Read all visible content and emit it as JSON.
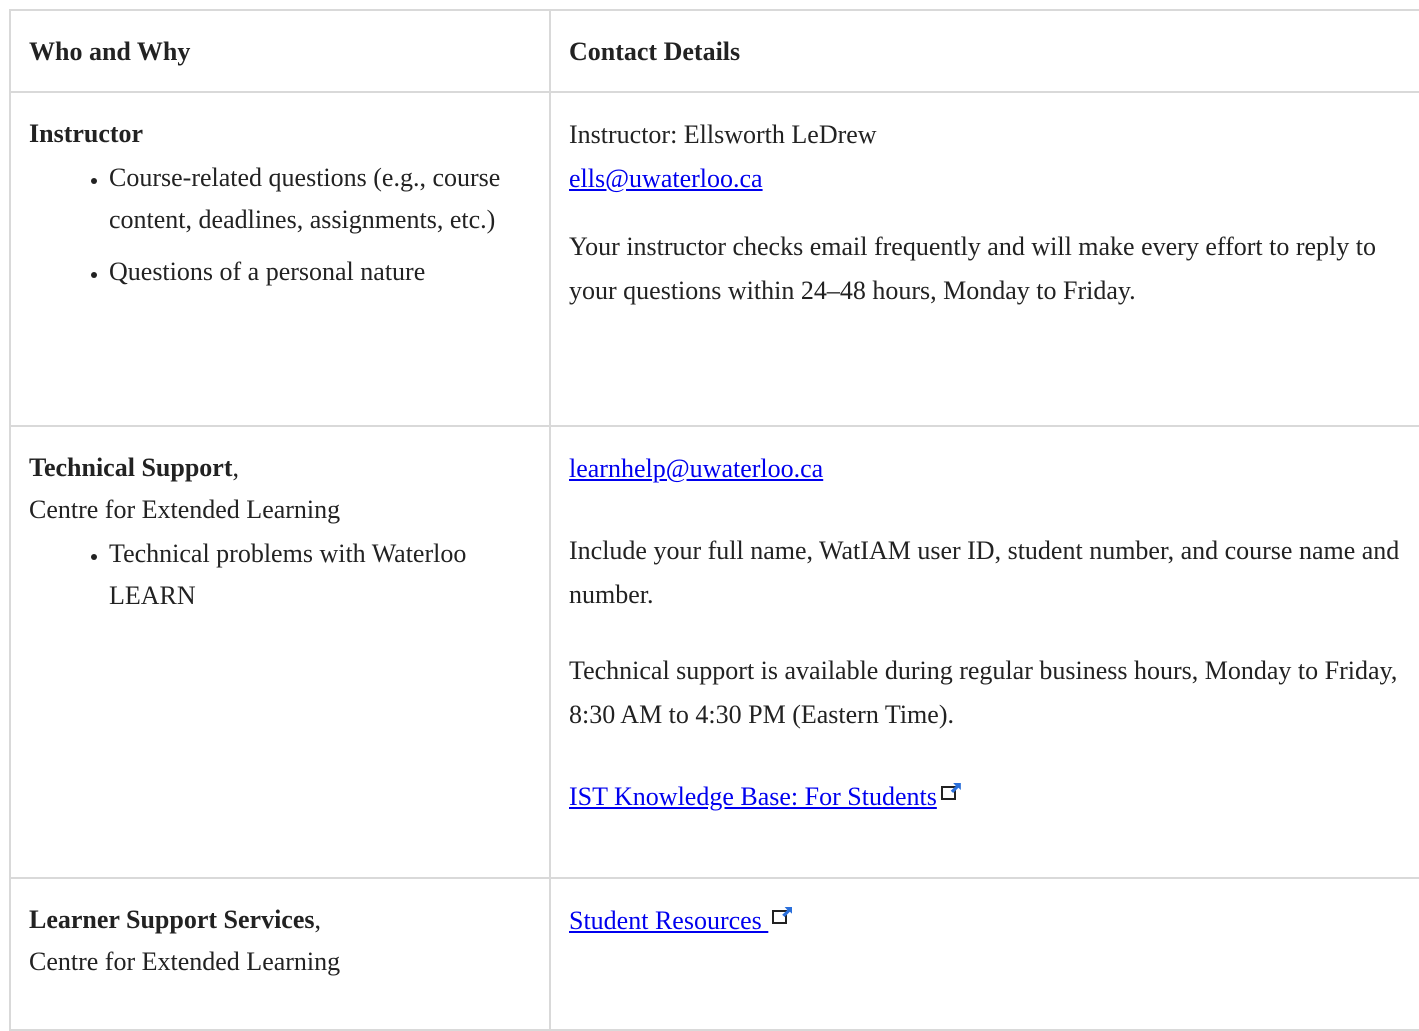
{
  "table": {
    "headers": [
      "Who and Why",
      "Contact Details"
    ]
  },
  "instructor": {
    "title": "Instructor",
    "reasons": [
      "Course-related questions (e.g., course content, deadlines, assignments, etc.)",
      "Questions of a personal nature"
    ],
    "name_line": "Instructor: Ellsworth LeDrew",
    "email": "ells@uwaterloo.ca",
    "note": "Your instructor checks email frequently and will make every effort to reply to your questions within 24–48 hours, Monday to Friday."
  },
  "tech": {
    "title": "Technical Support",
    "suffix": ",",
    "unit": "Centre for Extended Learning",
    "reasons": [
      "Technical problems with Waterloo LEARN"
    ],
    "email": "learnhelp@uwaterloo.ca",
    "include_note": "Include your full name, WatIAM user ID, student number, and course name and number.",
    "hours_note": "Technical support is available during regular business hours, Monday to Friday, 8:30 AM to 4:30 PM (Eastern Time).",
    "kb_link": "IST Knowledge Base: For Students"
  },
  "learner": {
    "title": "Learner Support Services",
    "suffix": ",",
    "unit": "Centre for Extended Learning",
    "resources_link": "Student Resources "
  },
  "icons": {
    "external_link": "external-link-icon"
  },
  "colors": {
    "link": "#0000ee",
    "border": "#d9d9d9",
    "text": "#222222"
  }
}
